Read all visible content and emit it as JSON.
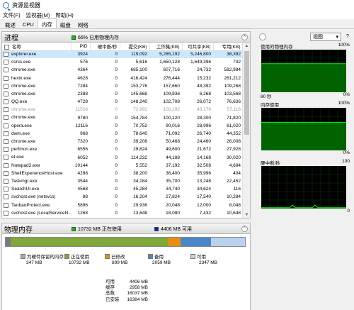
{
  "window": {
    "title": "资源监视器"
  },
  "menu": [
    "文件(F)",
    "监视器(M)",
    "帮助(H)"
  ],
  "tabs": [
    {
      "label": "概述",
      "active": false
    },
    {
      "label": "CPU",
      "active": false
    },
    {
      "label": "内存",
      "active": true
    },
    {
      "label": "磁盘",
      "active": false
    },
    {
      "label": "网络",
      "active": false
    }
  ],
  "process": {
    "title": "进程",
    "stat": "66% 已用物理内存",
    "stat_color": "#00c800",
    "columns": [
      "名称",
      "PID",
      "硬中断/秒",
      "提交(KB)",
      "工作集(KB)",
      "可共享(KB)",
      "专用(KB)"
    ],
    "rows": [
      [
        "explorer.exe",
        "3924",
        "0",
        "119,092",
        "5,285,192",
        "5,246,800",
        "38,392",
        "sel"
      ],
      [
        "csrss.exe",
        "576",
        "0",
        "5,616",
        "1,650,128",
        "1,649,396",
        "732",
        ""
      ],
      [
        "chrome.exe",
        "4364",
        "0",
        "685,100",
        "607,716",
        "24,732",
        "582,984",
        ""
      ],
      [
        "hexin.exe",
        "4628",
        "0",
        "416,424",
        "276,444",
        "15,232",
        "261,212",
        ""
      ],
      [
        "chrome.exe",
        "7284",
        "0",
        "153,776",
        "157,660",
        "48,392",
        "109,268",
        ""
      ],
      [
        "chrome.exe",
        "2388",
        "0",
        "145,668",
        "109,836",
        "6,268",
        "103,568",
        ""
      ],
      [
        "QQ.exe",
        "4728",
        "0",
        "148,240",
        "102,708",
        "26,072",
        "76,636",
        ""
      ],
      [
        "chrome.exe",
        "11528",
        "0",
        "72,992",
        "100,292",
        "43,176",
        "57,116",
        "dim"
      ],
      [
        "chrome.exe",
        "9780",
        "0",
        "154,784",
        "100,120",
        "28,300",
        "71,820",
        ""
      ],
      [
        "opera.exe",
        "12116",
        "0",
        "70,752",
        "90,016",
        "28,996",
        "61,020",
        ""
      ],
      [
        "dwm.exe",
        "968",
        "0",
        "78,640",
        "71,092",
        "26,740",
        "44,352",
        ""
      ],
      [
        "chrome.exe",
        "7320",
        "0",
        "39,208",
        "50,468",
        "24,460",
        "26,008",
        ""
      ],
      [
        "perfmon.exe",
        "6556",
        "0",
        "29,824",
        "49,600",
        "21,672",
        "27,928",
        ""
      ],
      [
        "et.exe",
        "6052",
        "0",
        "114,232",
        "44,188",
        "14,168",
        "30,020",
        ""
      ],
      [
        "Notepad2.exe",
        "10144",
        "0",
        "5,552",
        "37,192",
        "32,508",
        "4,684",
        ""
      ],
      [
        "ShellExperienceHost.exe",
        "4288",
        "0",
        "38,200",
        "36,400",
        "35,996",
        "404",
        ""
      ],
      [
        "Taskmgr.exe",
        "3544",
        "0",
        "34,184",
        "35,700",
        "13,248",
        "22,452",
        ""
      ],
      [
        "SearchUI.exe",
        "4568",
        "0",
        "45,284",
        "34,740",
        "34,624",
        "116",
        ""
      ],
      [
        "svchost.exe (netsvcs)",
        "88",
        "0",
        "16,204",
        "27,824",
        "17,540",
        "10,284",
        ""
      ],
      [
        "TaobaoProtect.exe",
        "5896",
        "0",
        "29,936",
        "20,048",
        "12,000",
        "8,048",
        ""
      ],
      [
        "svchost.exe (LocalServiceN...",
        "1268",
        "0",
        "13,648",
        "18,080",
        "7,432",
        "10,648",
        ""
      ]
    ]
  },
  "memory": {
    "title": "物理内存",
    "stat_inuse": "10732 MB 正在使用",
    "stat_inuse_color": "#00c800",
    "stat_avail": "4406 MB 可用",
    "stat_avail_color": "#1e1eb4",
    "bar": [
      {
        "key": "reserved",
        "mb": 347,
        "color": "#7a7a7a"
      },
      {
        "key": "inuse",
        "mb": 10732,
        "color": "#7fa83a"
      },
      {
        "key": "modified",
        "mb": 899,
        "color": "#e88e12"
      },
      {
        "key": "standby",
        "mb": 2059,
        "color": "#4a86c8"
      },
      {
        "key": "free",
        "mb": 2347,
        "color": "#b9d3ee"
      }
    ],
    "legend": [
      {
        "label": "为硬件保留的内存",
        "value": "347 MB",
        "color": "#a8a8a8"
      },
      {
        "label": "正在使用",
        "value": "10732 MB",
        "color": "#7fa83a"
      },
      {
        "label": "已修改",
        "value": "899 MB",
        "color": "#e88e12"
      },
      {
        "label": "备用",
        "value": "2059 MB",
        "color": "#4a86c8"
      },
      {
        "label": "可用",
        "value": "2347 MB",
        "color": "#b9d3ee"
      }
    ],
    "totals": [
      {
        "k": "可用",
        "v": "4406 MB"
      },
      {
        "k": "缓存",
        "v": "2958 MB"
      },
      {
        "k": "总数",
        "v": "16037 MB"
      },
      {
        "k": "已安装",
        "v": "16384 MB"
      }
    ]
  },
  "right": {
    "view_label": "视图",
    "graphs": [
      {
        "title": "使用的物理内存",
        "top": "100%",
        "foot_left": "60 秒",
        "foot_right": "0%",
        "level": 0.67
      },
      {
        "title": "内存使用",
        "top": "100%",
        "foot_left": "",
        "foot_right": "0%",
        "level": 0.66
      },
      {
        "title": "硬中断/秒",
        "top": "100",
        "foot_left": "",
        "foot_right": "0",
        "level": 0.02
      }
    ],
    "graph_line_color": "#00ff00",
    "graph_fill_color": "#007a00"
  }
}
